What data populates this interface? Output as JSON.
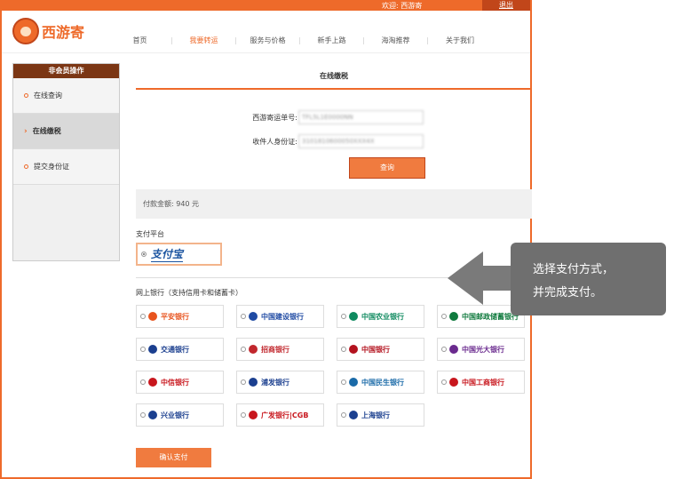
{
  "topbar": {
    "welcome": "欢迎: 西游寄",
    "logout": "退出"
  },
  "logo": {
    "text": "西游寄"
  },
  "nav": [
    {
      "label": "首页",
      "active": false
    },
    {
      "label": "我要转运",
      "active": true
    },
    {
      "label": "服务与价格",
      "active": false
    },
    {
      "label": "新手上路",
      "active": false
    },
    {
      "label": "海淘推荐",
      "active": false
    },
    {
      "label": "关于我们",
      "active": false
    }
  ],
  "sidebar": {
    "header": "非会员操作",
    "items": [
      {
        "label": "在线查询",
        "active": false
      },
      {
        "label": "在线缴税",
        "active": true
      },
      {
        "label": "提交身份证",
        "active": false
      }
    ]
  },
  "main": {
    "title": "在线缴税",
    "order_label": "西游寄运单号:",
    "order_value": "TFL5L1E0000NN",
    "id_label": "收件人身份证:",
    "id_value": "3101810600050XXX4X",
    "query_button": "查询",
    "amount": "付款金额: 940 元",
    "platform_label": "支付平台",
    "alipay": "支付宝",
    "bank_label": "网上银行（支持信用卡和储蓄卡）",
    "banks": [
      {
        "name": "平安银行",
        "color": "#e8541e"
      },
      {
        "name": "中国建设银行",
        "color": "#1f4aa3"
      },
      {
        "name": "中国农业银行",
        "color": "#0f8a5f"
      },
      {
        "name": "中国邮政储蓄银行",
        "color": "#0f7a3d"
      },
      {
        "name": "交通银行",
        "color": "#1b3f8f"
      },
      {
        "name": "招商银行",
        "color": "#c1272d"
      },
      {
        "name": "中国银行",
        "color": "#b3121e"
      },
      {
        "name": "中国光大银行",
        "color": "#6a2a8e"
      },
      {
        "name": "中信银行",
        "color": "#c8161d"
      },
      {
        "name": "浦发银行",
        "color": "#1b3f8f"
      },
      {
        "name": "中国民生银行",
        "color": "#1a6aa8"
      },
      {
        "name": "中国工商银行",
        "color": "#c8161d"
      },
      {
        "name": "兴业银行",
        "color": "#1b3f8f"
      },
      {
        "name": "广发银行|CGB",
        "color": "#c8161d"
      },
      {
        "name": "上海银行",
        "color": "#1b3f8f"
      }
    ],
    "confirm_button": "确认支付"
  },
  "callout": {
    "line1": "选择支付方式，",
    "line2": "并完成支付。"
  },
  "colors": {
    "accent": "#ee6a2a",
    "sidebar_header": "#7b3614",
    "callout": "#6f6f6f"
  }
}
